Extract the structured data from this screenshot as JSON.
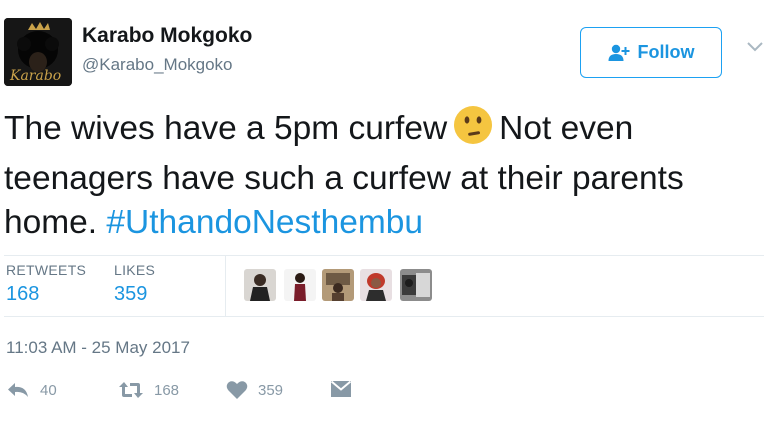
{
  "author": {
    "display_name": "Karabo Mokgoko",
    "handle": "@Karabo_Mokgoko",
    "avatar_text": "Karabo"
  },
  "follow_button": {
    "label": "Follow"
  },
  "tweet": {
    "text_part1": "The wives have a 5pm curfew",
    "emoji": "confused-face-emoji",
    "text_part2": "Not even teenagers have such a curfew at their parents home.",
    "hashtag": "#UthandoNesthembu"
  },
  "stats": {
    "retweets_label": "RETWEETS",
    "retweets_value": "168",
    "likes_label": "LIKES",
    "likes_value": "359"
  },
  "timestamp": "11:03 AM - 25 May 2017",
  "actions": {
    "reply_count": "40",
    "retweet_count": "168",
    "like_count": "359"
  },
  "colors": {
    "link": "#1b95e0",
    "secondary_text": "#657786",
    "action_icon": "#8899a6",
    "divider": "#e6ecf0"
  }
}
